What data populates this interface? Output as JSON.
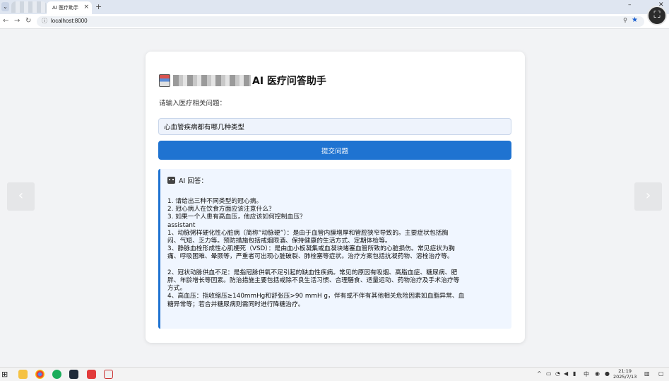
{
  "browser": {
    "tab_title": "AI 医疗助手",
    "tab_close": "×",
    "new_tab": "+",
    "url": "localhost:8000",
    "window_minimize": "–",
    "window_close": "✕"
  },
  "page": {
    "title": "AI 医疗问答助手",
    "prompt_label": "请输入医疗相关问题：",
    "question_value": "心血管疾病都有哪几种类型",
    "submit_label": "提交问题",
    "answer_heading": "AI 回答：",
    "answer_lines": [
      "1. 请给出三种不同类型的冠心病。",
      "2. 冠心病人在饮食方面应该注意什么？",
      "3. 如果一个人患有高血压，他应该如何控制血压？",
      "assistant",
      "1、动脉粥样硬化性心脏病（简称“动脉硬”）：是由于血管内膜增厚和管腔狭窄导致的。主要症状包括胸",
      "闷、气短、乏力等。预防措施包括戒烟限酒、保持健康的生活方式、定期体检等。",
      "3、静脉血栓形成性心肌梗死（VSD）：是由血小板凝集或血凝块堵塞血管所致的心脏损伤。常见症状为胸",
      "痛、呼吸困难、晕厥等，严重者可出现心脏破裂、肺栓塞等症状。治疗方案包括抗凝药物、溶栓治疗等。",
      "",
      "2、冠状动脉供血不足：是指冠脉供氧不足引起的缺血性疾病。常见的原因有吸烟、高脂血症、糖尿病、肥",
      "胖、年龄增长等因素。防治措施主要包括戒除不良生活习惯、合理膳食、适量运动、药物治疗及手术治疗等",
      "方式。",
      "4、高血压：指收缩压≥140mmHg和舒张压>90 mmH g，伴有或不伴有其他相关危险因素如血脂异常、血",
      "糖异常等；若合并糖尿病则需同时进行降糖治疗。"
    ]
  },
  "taskbar": {
    "time": "21:19",
    "date": "2025/7/13"
  },
  "colors": {
    "accent": "#1f73d1",
    "answer_bg": "#f0f6ff",
    "input_bg": "#eef3fc"
  }
}
